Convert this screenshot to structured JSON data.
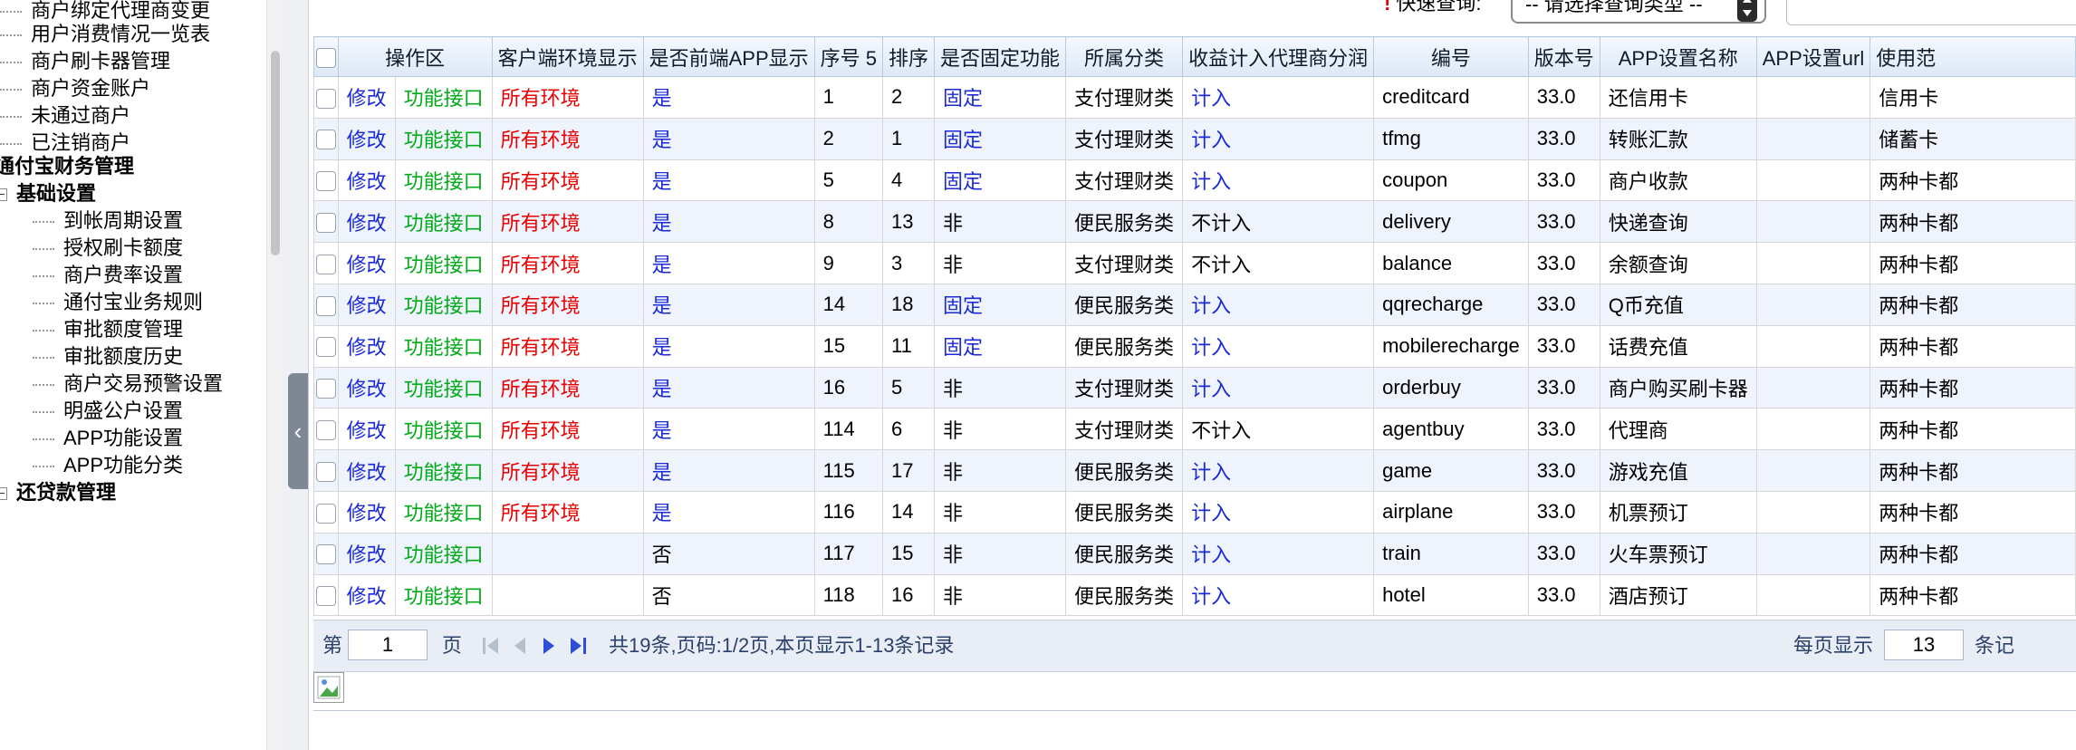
{
  "sidebar": {
    "items": [
      {
        "label": "商户绑定代理商变更",
        "level": 2
      },
      {
        "label": "用户消费情况一览表",
        "level": 2
      },
      {
        "label": "商户刷卡器管理",
        "level": 2
      },
      {
        "label": "商户资金账户",
        "level": 2
      },
      {
        "label": "未通过商户",
        "level": 2
      },
      {
        "label": "已注销商户",
        "level": 2
      },
      {
        "label": "通付宝财务管理",
        "level": 0
      },
      {
        "label": "基础设置",
        "level": 1
      },
      {
        "label": "到帐周期设置",
        "level": 3
      },
      {
        "label": "授权刷卡额度",
        "level": 3
      },
      {
        "label": "商户费率设置",
        "level": 3
      },
      {
        "label": "通付宝业务规则",
        "level": 3
      },
      {
        "label": "审批额度管理",
        "level": 3
      },
      {
        "label": "审批额度历史",
        "level": 3
      },
      {
        "label": "商户交易预警设置",
        "level": 3
      },
      {
        "label": "明盛公户设置",
        "level": 3
      },
      {
        "label": "APP功能设置",
        "level": 3
      },
      {
        "label": "APP功能分类",
        "level": 3
      },
      {
        "label": "还贷款管理",
        "level": 1
      }
    ]
  },
  "query": {
    "label": "快速查询:",
    "select_value": "-- 请选择查询类型 --"
  },
  "table": {
    "headers": [
      "",
      "操作区",
      "客户端环境显示",
      "是否前端APP显示",
      "序号 5",
      "排序",
      "是否固定功能",
      "所属分类",
      "收益计入代理商分润",
      "编号",
      "版本号",
      "APP设置名称",
      "APP设置url",
      "使用范"
    ],
    "rows": [
      {
        "edit": "修改",
        "api": "功能接口",
        "env": "所有环境",
        "show": "是",
        "seq": "1",
        "sort": "2",
        "fixed": "固定",
        "category": "支付理财类",
        "profit": "计入",
        "code": "creditcard",
        "version": "33.0",
        "name": "还信用卡",
        "url": "",
        "scope": "信用卡"
      },
      {
        "edit": "修改",
        "api": "功能接口",
        "env": "所有环境",
        "show": "是",
        "seq": "2",
        "sort": "1",
        "fixed": "固定",
        "category": "支付理财类",
        "profit": "计入",
        "code": "tfmg",
        "version": "33.0",
        "name": "转账汇款",
        "url": "",
        "scope": "储蓄卡"
      },
      {
        "edit": "修改",
        "api": "功能接口",
        "env": "所有环境",
        "show": "是",
        "seq": "5",
        "sort": "4",
        "fixed": "固定",
        "category": "支付理财类",
        "profit": "计入",
        "code": "coupon",
        "version": "33.0",
        "name": "商户收款",
        "url": "",
        "scope": "两种卡都"
      },
      {
        "edit": "修改",
        "api": "功能接口",
        "env": "所有环境",
        "show": "是",
        "seq": "8",
        "sort": "13",
        "fixed": "非",
        "category": "便民服务类",
        "profit": "不计入",
        "code": "delivery",
        "version": "33.0",
        "name": "快递查询",
        "url": "",
        "scope": "两种卡都"
      },
      {
        "edit": "修改",
        "api": "功能接口",
        "env": "所有环境",
        "show": "是",
        "seq": "9",
        "sort": "3",
        "fixed": "非",
        "category": "支付理财类",
        "profit": "不计入",
        "code": "balance",
        "version": "33.0",
        "name": "余额查询",
        "url": "",
        "scope": "两种卡都"
      },
      {
        "edit": "修改",
        "api": "功能接口",
        "env": "所有环境",
        "show": "是",
        "seq": "14",
        "sort": "18",
        "fixed": "固定",
        "category": "便民服务类",
        "profit": "计入",
        "code": "qqrecharge",
        "version": "33.0",
        "name": "Q币充值",
        "url": "",
        "scope": "两种卡都"
      },
      {
        "edit": "修改",
        "api": "功能接口",
        "env": "所有环境",
        "show": "是",
        "seq": "15",
        "sort": "11",
        "fixed": "固定",
        "category": "便民服务类",
        "profit": "计入",
        "code": "mobilerecharge",
        "version": "33.0",
        "name": "话费充值",
        "url": "",
        "scope": "两种卡都"
      },
      {
        "edit": "修改",
        "api": "功能接口",
        "env": "所有环境",
        "show": "是",
        "seq": "16",
        "sort": "5",
        "fixed": "非",
        "category": "支付理财类",
        "profit": "计入",
        "code": "orderbuy",
        "version": "33.0",
        "name": "商户购买刷卡器",
        "url": "",
        "scope": "两种卡都"
      },
      {
        "edit": "修改",
        "api": "功能接口",
        "env": "所有环境",
        "show": "是",
        "seq": "114",
        "sort": "6",
        "fixed": "非",
        "category": "支付理财类",
        "profit": "不计入",
        "code": "agentbuy",
        "version": "33.0",
        "name": "代理商",
        "url": "",
        "scope": "两种卡都"
      },
      {
        "edit": "修改",
        "api": "功能接口",
        "env": "所有环境",
        "show": "是",
        "seq": "115",
        "sort": "17",
        "fixed": "非",
        "category": "便民服务类",
        "profit": "计入",
        "code": "game",
        "version": "33.0",
        "name": "游戏充值",
        "url": "",
        "scope": "两种卡都"
      },
      {
        "edit": "修改",
        "api": "功能接口",
        "env": "所有环境",
        "show": "是",
        "seq": "116",
        "sort": "14",
        "fixed": "非",
        "category": "便民服务类",
        "profit": "计入",
        "code": "airplane",
        "version": "33.0",
        "name": "机票预订",
        "url": "",
        "scope": "两种卡都"
      },
      {
        "edit": "修改",
        "api": "功能接口",
        "env": "",
        "show": "否",
        "seq": "117",
        "sort": "15",
        "fixed": "非",
        "category": "便民服务类",
        "profit": "计入",
        "code": "train",
        "version": "33.0",
        "name": "火车票预订",
        "url": "",
        "scope": "两种卡都"
      },
      {
        "edit": "修改",
        "api": "功能接口",
        "env": "",
        "show": "否",
        "seq": "118",
        "sort": "16",
        "fixed": "非",
        "category": "便民服务类",
        "profit": "计入",
        "code": "hotel",
        "version": "33.0",
        "name": "酒店预订",
        "url": "",
        "scope": "两种卡都"
      }
    ]
  },
  "pager": {
    "page_prefix": "第",
    "page_value": "1",
    "page_suffix": "页",
    "summary": "共19条,页码:1/2页,本页显示1-13条记录",
    "size_label": "每页显示",
    "size_value": "13",
    "size_suffix": "条记"
  },
  "colors": {
    "link_blue": "#1a2ad6",
    "link_green": "#00aa18",
    "env_red": "#e80000",
    "row_alt": "#eef3fc",
    "header_bg": "#dde8f6",
    "pager_bg": "#e9eef6"
  },
  "icons": {
    "first": "first-page-icon",
    "prev": "prev-page-icon",
    "next": "next-page-icon",
    "last": "last-page-icon",
    "collapse": "collapse-left-icon",
    "broken_image": "broken-image-icon"
  }
}
